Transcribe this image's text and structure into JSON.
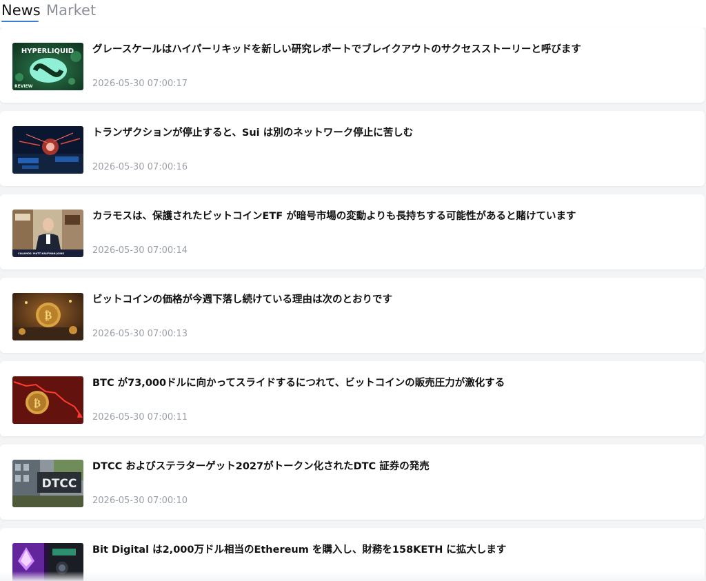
{
  "tabs": {
    "news_label": "News",
    "market_label": "Market",
    "active": "News",
    "accent_color": "#3b7bd4"
  },
  "news": [
    {
      "title": "グレースケールはハイパーリキッドを新しい研究レポートでブレイクアウトのサクセスストーリーと呼びます",
      "time": "2026-05-30 07:00:17",
      "thumb_top_text": "HYPERLIQUID",
      "thumb_bottom_text": "REVIEW"
    },
    {
      "title": "トランザクションが停止すると、Sui は別のネットワーク停止に苦しむ",
      "time": "2026-05-30 07:00:16"
    },
    {
      "title": "カラモスは、保護されたビットコインETF が暗号市場の変動よりも長持ちする可能性があると賭けています",
      "time": "2026-05-30 07:00:14",
      "thumb_caption": "CALAMOS' MATT KAUFMAN JOINS"
    },
    {
      "title": "ビットコインの価格が今週下落し続けている理由は次のとおりです",
      "time": "2026-05-30 07:00:13"
    },
    {
      "title": "BTC が73,000ドルに向かってスライドするにつれて、ビットコインの販売圧力が激化する",
      "time": "2026-05-30 07:00:11"
    },
    {
      "title": "DTCC およびステラターゲット2027がトークン化されたDTC 証券の発売",
      "time": "2026-05-30 07:00:10",
      "thumb_sign_text": "DTCC"
    },
    {
      "title": "Bit Digital は2,000万ドル相当のEthereum を購入し、財務を158KETH に拡大します",
      "time": ""
    }
  ]
}
